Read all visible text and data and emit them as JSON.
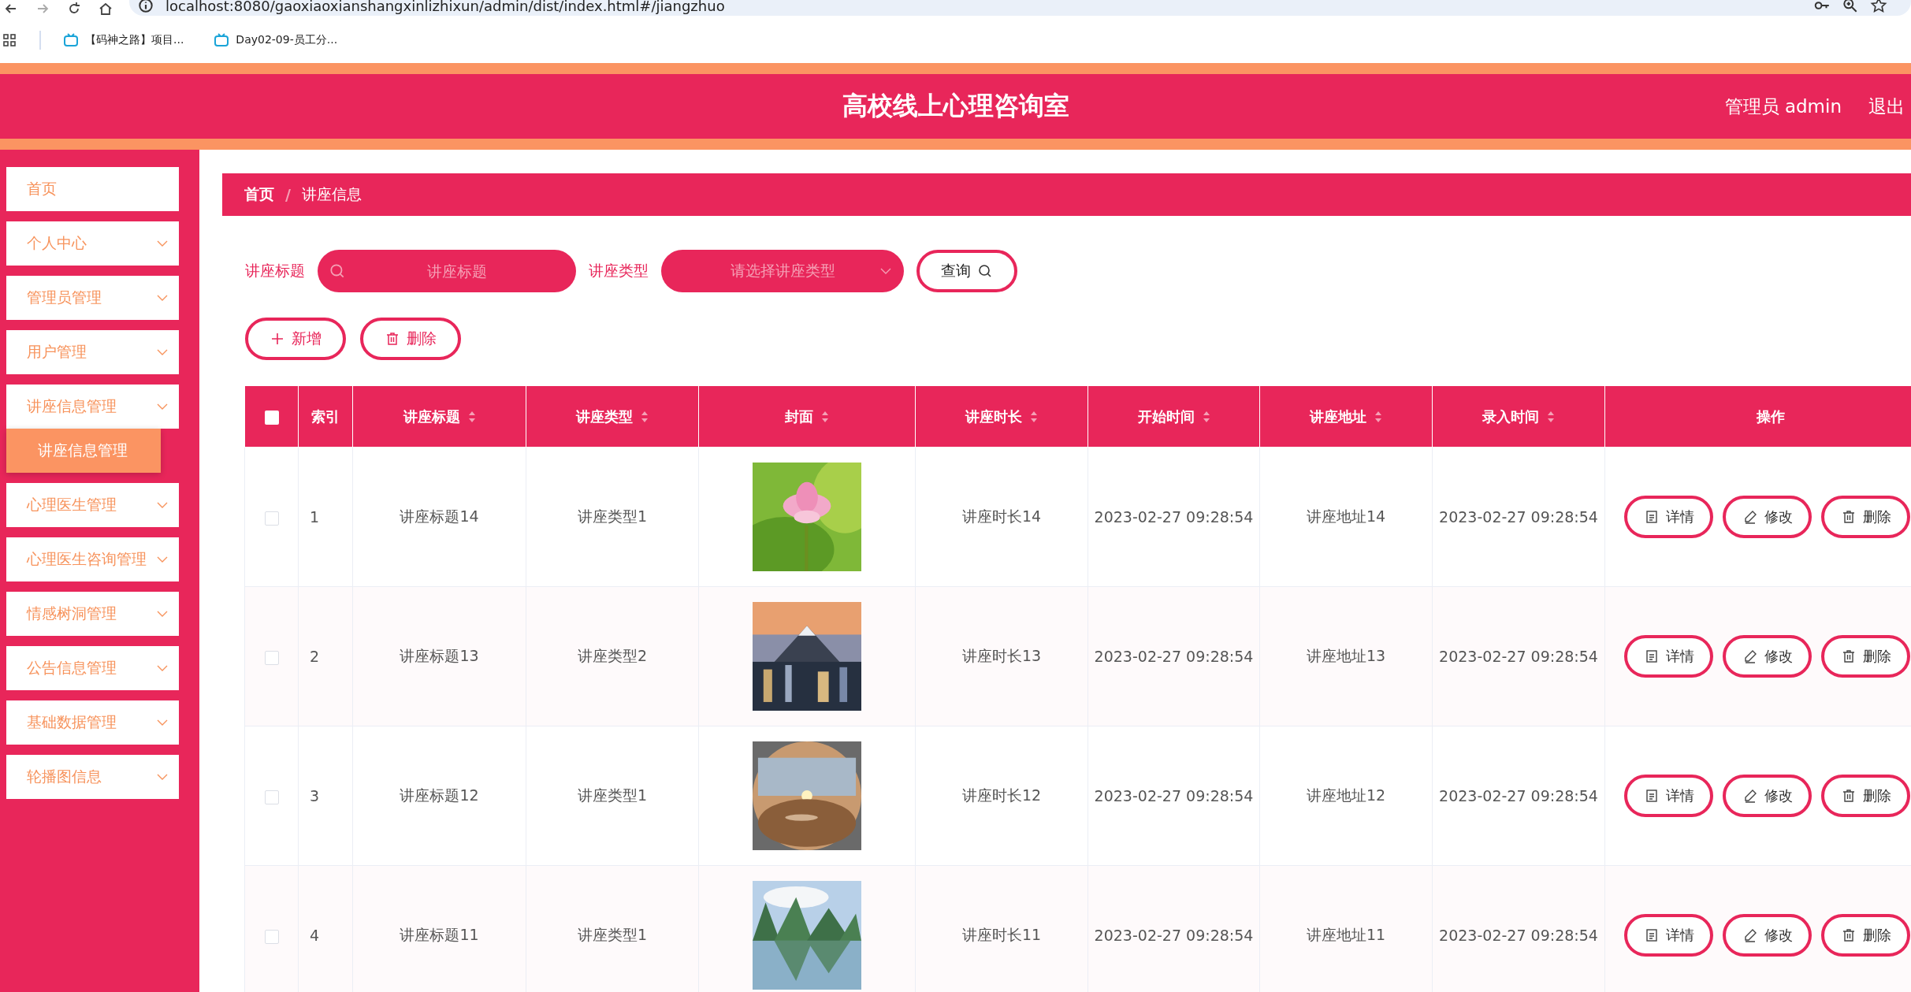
{
  "browser": {
    "url": "localhost:8080/gaoxiaoxianshangxinlizhixun/admin/dist/index.html#/jiangzhuo",
    "bookmarks": [
      "【码神之路】项目...",
      "Day02-09-员工分..."
    ]
  },
  "header": {
    "title": "高校线上心理咨询室",
    "user": "管理员 admin",
    "logout": "退出"
  },
  "sidebar": {
    "items": [
      {
        "label": "首页",
        "kind": "link"
      },
      {
        "label": "个人中心",
        "kind": "submenu"
      },
      {
        "label": "管理员管理",
        "kind": "submenu"
      },
      {
        "label": "用户管理",
        "kind": "submenu"
      },
      {
        "label": "讲座信息管理",
        "kind": "submenu",
        "children": [
          {
            "label": "讲座信息管理",
            "selected": true
          }
        ]
      },
      {
        "label": "心理医生管理",
        "kind": "submenu"
      },
      {
        "label": "心理医生咨询管理",
        "kind": "submenu"
      },
      {
        "label": "情感树洞管理",
        "kind": "submenu"
      },
      {
        "label": "公告信息管理",
        "kind": "submenu"
      },
      {
        "label": "基础数据管理",
        "kind": "submenu"
      },
      {
        "label": "轮播图信息",
        "kind": "submenu"
      }
    ]
  },
  "breadcrumb": {
    "items": [
      "首页",
      "讲座信息"
    ],
    "separator": "/"
  },
  "search": {
    "title_label": "讲座标题",
    "title_placeholder": "讲座标题",
    "type_label": "讲座类型",
    "type_placeholder": "请选择讲座类型",
    "query": "查询"
  },
  "actions": [
    "新增",
    "删除"
  ],
  "table": {
    "select_all": false,
    "columns": [
      {
        "label": "索引",
        "sortable": false
      },
      {
        "label": "讲座标题",
        "sortable": true
      },
      {
        "label": "讲座类型",
        "sortable": true
      },
      {
        "label": "封面",
        "sortable": true
      },
      {
        "label": "讲座时长",
        "sortable": true
      },
      {
        "label": "开始时间",
        "sortable": true
      },
      {
        "label": "讲座地址",
        "sortable": true
      },
      {
        "label": "录入时间",
        "sortable": true
      },
      {
        "label": "操作",
        "sortable": false
      }
    ],
    "rows": [
      {
        "checked": false,
        "index": "1",
        "title": "讲座标题14",
        "type": "讲座类型1",
        "duration": "讲座时长14",
        "start": "2023-02-27 09:28:54",
        "address": "讲座地址14",
        "created": "2023-02-27 09:28:54",
        "buttons": [
          "详情",
          "修改",
          "删除"
        ]
      },
      {
        "checked": false,
        "index": "2",
        "title": "讲座标题13",
        "type": "讲座类型2",
        "duration": "讲座时长13",
        "start": "2023-02-27 09:28:54",
        "address": "讲座地址13",
        "created": "2023-02-27 09:28:54",
        "buttons": [
          "详情",
          "修改",
          "删除"
        ]
      },
      {
        "checked": false,
        "index": "3",
        "title": "讲座标题12",
        "type": "讲座类型1",
        "duration": "讲座时长12",
        "start": "2023-02-27 09:28:54",
        "address": "讲座地址12",
        "created": "2023-02-27 09:28:54",
        "buttons": [
          "详情",
          "修改",
          "删除"
        ]
      },
      {
        "checked": false,
        "index": "4",
        "title": "讲座标题11",
        "type": "讲座类型1",
        "duration": "讲座时长11",
        "start": "2023-02-27 09:28:54",
        "address": "讲座地址11",
        "created": "2023-02-27 09:28:54",
        "buttons": [
          "详情",
          "修改",
          "删除"
        ]
      }
    ]
  }
}
